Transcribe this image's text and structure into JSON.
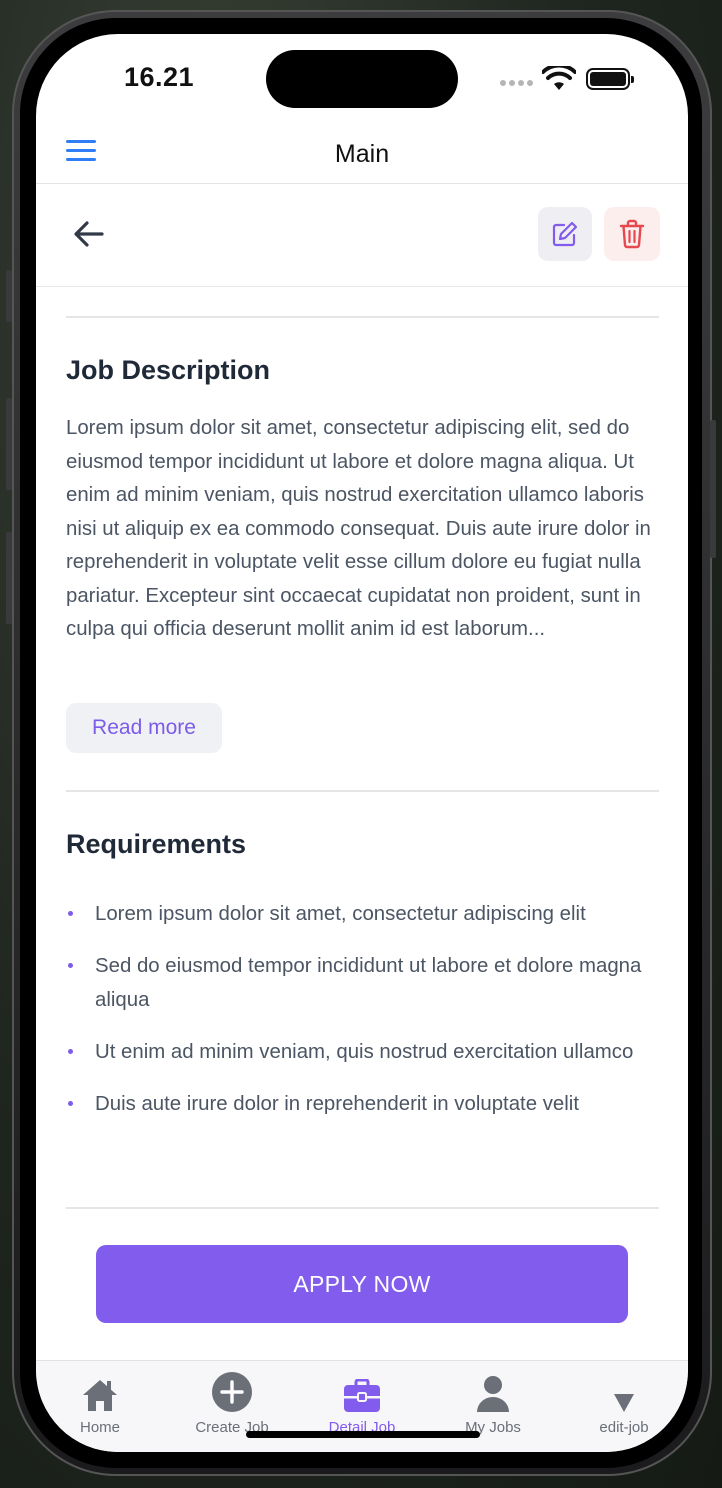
{
  "status_bar": {
    "time": "16.21"
  },
  "header": {
    "title": "Main"
  },
  "job_description": {
    "title": "Job Description",
    "text": "Lorem ipsum dolor sit amet, consectetur adipiscing elit, sed do eiusmod tempor incididunt ut labore et dolore magna aliqua. Ut enim ad minim veniam, quis nostrud exercitation ullamco laboris nisi ut aliquip ex ea commodo consequat. Duis aute irure dolor in reprehenderit in voluptate velit esse cillum dolore eu fugiat nulla pariatur. Excepteur sint occaecat cupidatat non proident, sunt in culpa qui officia deserunt mollit anim id est laborum...",
    "read_more_label": "Read more"
  },
  "requirements": {
    "title": "Requirements",
    "items": [
      "Lorem ipsum dolor sit amet, consectetur adipiscing elit",
      "Sed do eiusmod tempor incididunt ut labore et dolore magna aliqua",
      "Ut enim ad minim veniam, quis nostrud exercitation ullamco",
      "Duis aute irure dolor in reprehenderit in voluptate velit"
    ]
  },
  "apply_label": "APPLY NOW",
  "bottom_nav": {
    "items": [
      {
        "label": "Home",
        "icon": "home-icon",
        "active": false
      },
      {
        "label": "Create Job",
        "icon": "plus-circle-icon",
        "active": false
      },
      {
        "label": "Detail Job",
        "icon": "briefcase-icon",
        "active": true
      },
      {
        "label": "My Jobs",
        "icon": "person-icon",
        "active": false
      },
      {
        "label": "edit-job",
        "icon": "triangle-down-icon",
        "active": false
      }
    ]
  },
  "colors": {
    "accent": "#825cec",
    "menu_blue": "#2f7ef5",
    "delete_red": "#e5484d",
    "text_body": "#4b5563",
    "text_heading": "#1f2937"
  }
}
